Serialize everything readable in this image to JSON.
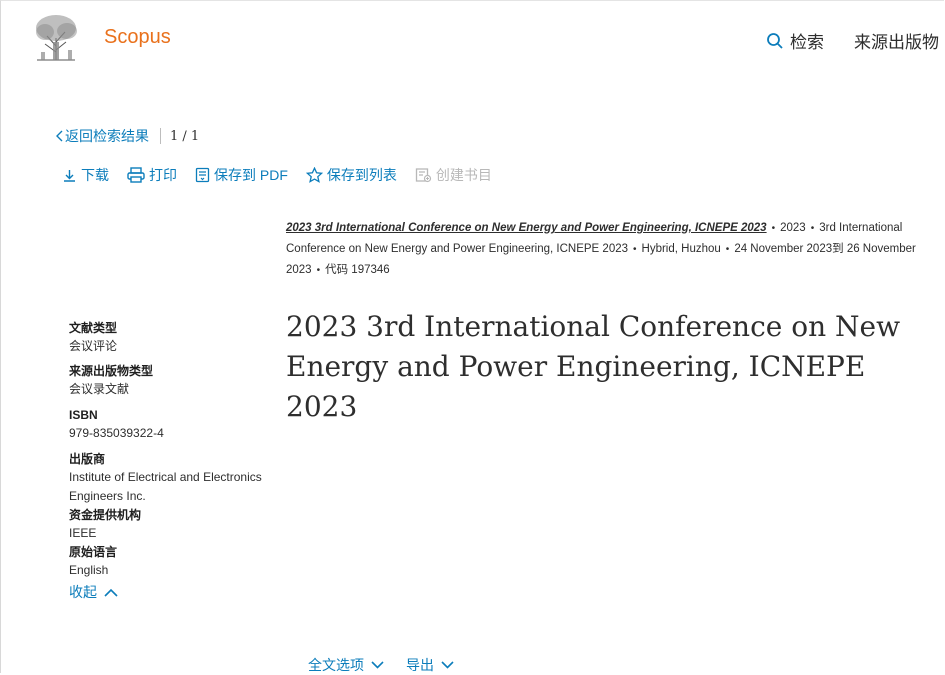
{
  "header": {
    "brand": "Scopus",
    "search_label": "检索",
    "sources_label": "来源出版物"
  },
  "nav": {
    "back_label": "返回检索结果",
    "pager": "1 / 1"
  },
  "toolbar": {
    "download": "下载",
    "print": "打印",
    "save_pdf": "保存到 PDF",
    "save_list": "保存到列表",
    "create_bib": "创建书目"
  },
  "source": {
    "title": "2023 3rd International Conference on New Energy and Power Engineering, ICNEPE 2023",
    "year": "2023",
    "conference": "3rd International Conference on New Energy and Power Engineering, ICNEPE 2023",
    "location": "Hybrid, Huzhou",
    "dates": "24 November 2023到 26 November 2023",
    "code": "代码 197346"
  },
  "document": {
    "title": "2023 3rd International Conference on New Energy and Power Engineering, ICNEPE 2023"
  },
  "meta": [
    {
      "label": "文献类型",
      "value": "会议评论"
    },
    {
      "label": "来源出版物类型",
      "value": "会议录文献"
    },
    {
      "label": "ISBN",
      "value": "979-835039322-4"
    },
    {
      "label": "出版商",
      "value": "Institute of Electrical and Electronics Engineers Inc."
    },
    {
      "label": "资金提供机构",
      "value": "IEEE"
    },
    {
      "label": "原始语言",
      "value": "English"
    }
  ],
  "collapse_label": "收起",
  "bottom": {
    "full_text": "全文选项",
    "export": "导出"
  },
  "colors": {
    "brand": "#e9711c",
    "link": "#0c7dbb",
    "disabled": "#b8b8b8"
  }
}
